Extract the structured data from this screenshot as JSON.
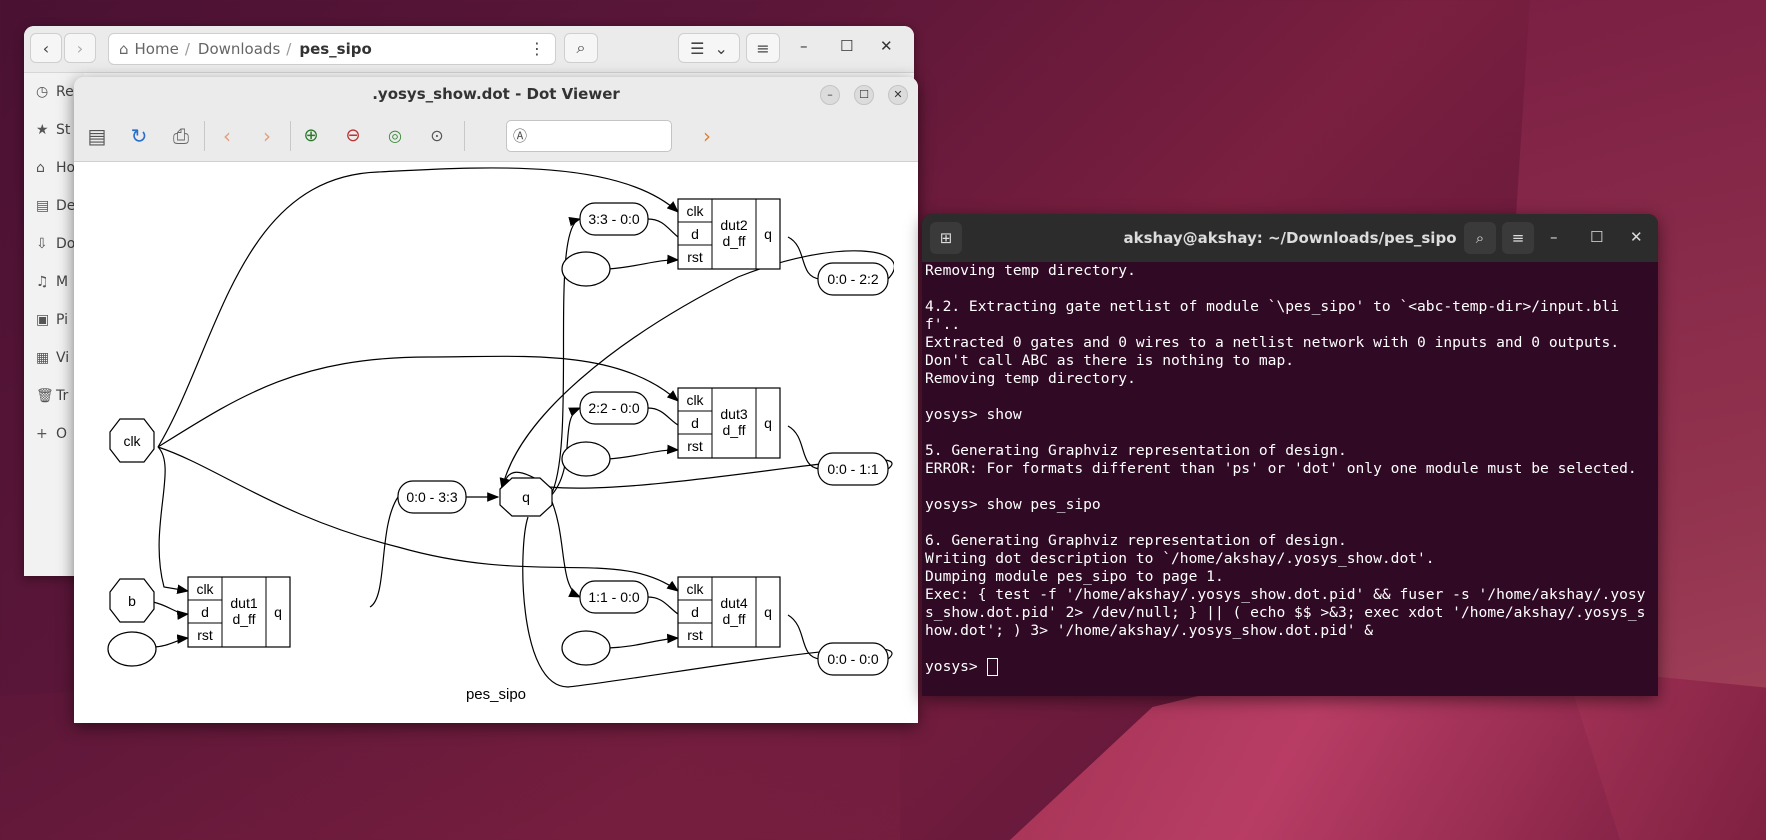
{
  "files": {
    "path": [
      "Home",
      "Downloads",
      "pes_sipo"
    ],
    "sidebar": [
      "Re",
      "St",
      "Ho",
      "De",
      "Do",
      "M",
      "Pi",
      "Vi",
      "Tr",
      "O"
    ]
  },
  "viewer": {
    "title": ".yosys_show.dot - Dot Viewer",
    "search_placeholder": ""
  },
  "graph": {
    "caption": "pes_sipo",
    "inputs": [
      "clk",
      "b",
      ""
    ],
    "cells": [
      {
        "name": "dut1",
        "type": "d_ff",
        "ports": [
          "clk",
          "d",
          "rst"
        ],
        "out": "q"
      },
      {
        "name": "dut2",
        "type": "d_ff",
        "ports": [
          "clk",
          "d",
          "rst"
        ],
        "out": "q"
      },
      {
        "name": "dut3",
        "type": "d_ff",
        "ports": [
          "clk",
          "d",
          "rst"
        ],
        "out": "q"
      },
      {
        "name": "dut4",
        "type": "d_ff",
        "ports": [
          "clk",
          "d",
          "rst"
        ],
        "out": "q"
      }
    ],
    "slices": [
      "3:3 - 0:0",
      "2:2 - 0:0",
      "1:1 - 0:0",
      "0:0 - 3:3",
      "0:0 - 2:2",
      "0:0 - 1:1",
      "0:0 - 0:0"
    ],
    "q_label": "q"
  },
  "terminal": {
    "title": "akshay@akshay: ~/Downloads/pes_sipo",
    "lines": [
      "Removing temp directory.",
      "",
      "4.2. Extracting gate netlist of module `\\pes_sipo' to `<abc-temp-dir>/input.blif'..",
      "Extracted 0 gates and 0 wires to a netlist network with 0 inputs and 0 outputs.",
      "Don't call ABC as there is nothing to map.",
      "Removing temp directory.",
      "",
      "yosys> show",
      "",
      "5. Generating Graphviz representation of design.",
      "ERROR: For formats different than 'ps' or 'dot' only one module must be selected.",
      "",
      "yosys> show pes_sipo",
      "",
      "6. Generating Graphviz representation of design.",
      "Writing dot description to `/home/akshay/.yosys_show.dot'.",
      "Dumping module pes_sipo to page 1.",
      "Exec: { test -f '/home/akshay/.yosys_show.dot.pid' && fuser -s '/home/akshay/.yosys_show.dot.pid' 2> /dev/null; } || ( echo $$ >&3; exec xdot '/home/akshay/.yosys_show.dot'; ) 3> '/home/akshay/.yosys_show.dot.pid' &",
      ""
    ],
    "prompt": "yosys> "
  }
}
